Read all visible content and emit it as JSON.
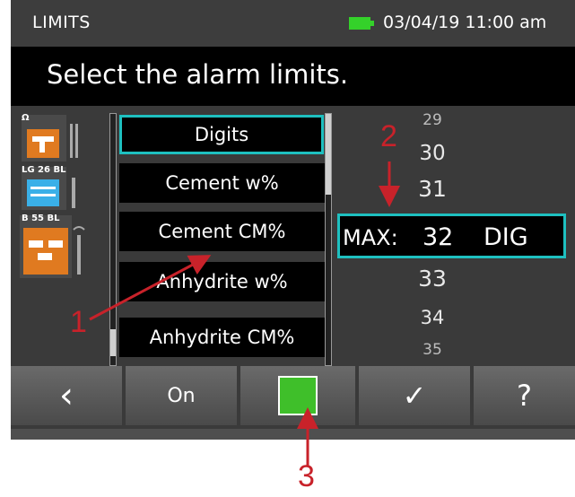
{
  "statusbar": {
    "title": "LIMITS",
    "datetime": "03/04/19 11:00 am",
    "battery_color": "#34d12a"
  },
  "instruction": {
    "text": "Select the alarm limits."
  },
  "sensors": [
    {
      "label": "Ω",
      "color": "#e07a20"
    },
    {
      "label": "LG 26 BL",
      "color": "#3ab0e8"
    },
    {
      "label": "B 55 BL",
      "color": "#e07a20"
    }
  ],
  "material_list": {
    "items": [
      "Digits",
      "Cement w%",
      "Cement CM%",
      "Anhydrite w%",
      "Anhydrite CM%"
    ],
    "selected_index": 0
  },
  "scale": {
    "above": [
      "29",
      "30",
      "31"
    ],
    "selected": {
      "label": "MAX:",
      "value": "32",
      "unit": "DIG"
    },
    "below": [
      "33",
      "34",
      "35"
    ]
  },
  "toolbar": {
    "back_icon": "‹",
    "on_label": "On",
    "color_indicator": "#3fbf2a",
    "confirm_icon": "✓",
    "help_label": "?"
  },
  "annotations": {
    "one": "1",
    "two": "2",
    "three": "3",
    "color": "#c8222a"
  }
}
